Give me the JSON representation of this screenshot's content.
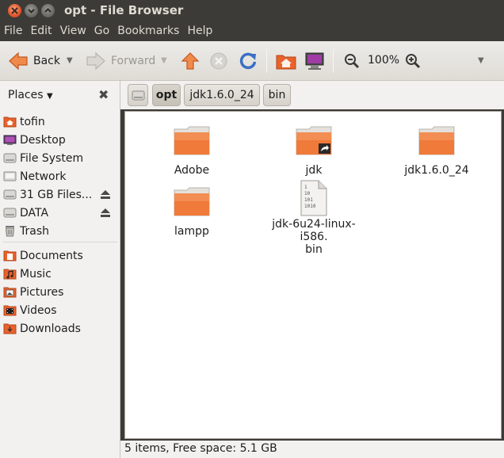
{
  "window": {
    "title": "opt - File Browser"
  },
  "menu": [
    "File",
    "Edit",
    "View",
    "Go",
    "Bookmarks",
    "Help"
  ],
  "toolbar": {
    "back_label": "Back",
    "forward_label": "Forward",
    "zoom": "100%"
  },
  "sidebar": {
    "header": "Places",
    "items": [
      {
        "label": "tofin",
        "icon": "home-folder-icon"
      },
      {
        "label": "Desktop",
        "icon": "desktop-icon"
      },
      {
        "label": "File System",
        "icon": "drive-icon"
      },
      {
        "label": "Network",
        "icon": "network-icon"
      },
      {
        "label": "31 GB Files...",
        "icon": "drive-icon"
      },
      {
        "label": "DATA",
        "icon": "drive-icon"
      },
      {
        "label": "Trash",
        "icon": "trash-icon"
      },
      {
        "label": "Documents",
        "icon": "documents-folder-icon"
      },
      {
        "label": "Music",
        "icon": "music-folder-icon"
      },
      {
        "label": "Pictures",
        "icon": "pictures-folder-icon"
      },
      {
        "label": "Videos",
        "icon": "videos-folder-icon"
      },
      {
        "label": "Downloads",
        "icon": "downloads-folder-icon"
      }
    ]
  },
  "path": [
    "opt",
    "jdk1.6.0_24",
    "bin"
  ],
  "files": [
    {
      "name": "Adobe",
      "type": "folder"
    },
    {
      "name": "jdk",
      "type": "folder-link"
    },
    {
      "name": "jdk1.6.0_24",
      "type": "folder"
    },
    {
      "name": "lampp",
      "type": "folder"
    },
    {
      "name": "jdk-6u24-linux-i586.bin",
      "name_line1": "jdk-6u24-linux-i586.",
      "name_line2": "bin",
      "type": "binary",
      "icon_text": [
        "1",
        "10",
        "101",
        "1010"
      ]
    }
  ],
  "status": "5 items, Free space: 5.1 GB",
  "colors": {
    "accent": "#e2542a",
    "folder": "#f07a3a",
    "chrome": "#3c3b37"
  }
}
